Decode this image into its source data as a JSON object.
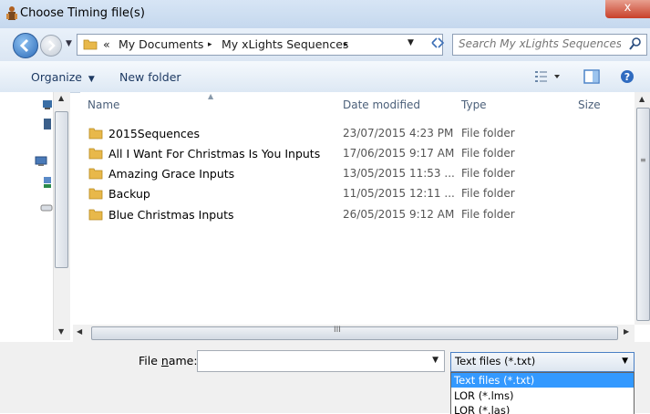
{
  "window": {
    "title": "Choose Timing file(s)",
    "close_label": "x"
  },
  "address": {
    "overflow": "«",
    "crumbs": [
      "My Documents",
      "My xLights Sequences"
    ],
    "separator": "▸"
  },
  "search": {
    "placeholder": "Search My xLights Sequences"
  },
  "toolbar": {
    "organize_label": "Organize",
    "new_folder_label": "New folder"
  },
  "columns": {
    "name": "Name",
    "date": "Date modified",
    "type": "Type",
    "size": "Size"
  },
  "files": [
    {
      "name": "2015Sequences",
      "date": "23/07/2015 4:23 PM",
      "type": "File folder"
    },
    {
      "name": "All I Want For Christmas Is You Inputs",
      "date": "17/06/2015 9:17 AM",
      "type": "File folder"
    },
    {
      "name": "Amazing Grace Inputs",
      "date": "13/05/2015 11:53 ...",
      "type": "File folder"
    },
    {
      "name": "Backup",
      "date": "11/05/2015 12:11 ...",
      "type": "File folder"
    },
    {
      "name": "Blue Christmas Inputs",
      "date": "26/05/2015 9:12 AM",
      "type": "File folder"
    }
  ],
  "filename": {
    "label_prefix": "File ",
    "label_accel": "n",
    "label_suffix": "ame:",
    "value": ""
  },
  "filetype": {
    "selected": "Text files (*.txt)",
    "options": [
      "Text files (*.txt)",
      "LOR (*.lms)",
      "LOR (*.las)"
    ]
  },
  "colors": {
    "accent": "#3399ff",
    "close": "#c8402a",
    "folder": "#e8b84a"
  },
  "icons": {
    "app": "xlights-app-icon",
    "back": "back-arrow-icon",
    "forward": "forward-arrow-icon",
    "search": "magnifier-icon",
    "views": "view-options-icon",
    "preview": "preview-pane-icon",
    "help": "help-icon"
  }
}
